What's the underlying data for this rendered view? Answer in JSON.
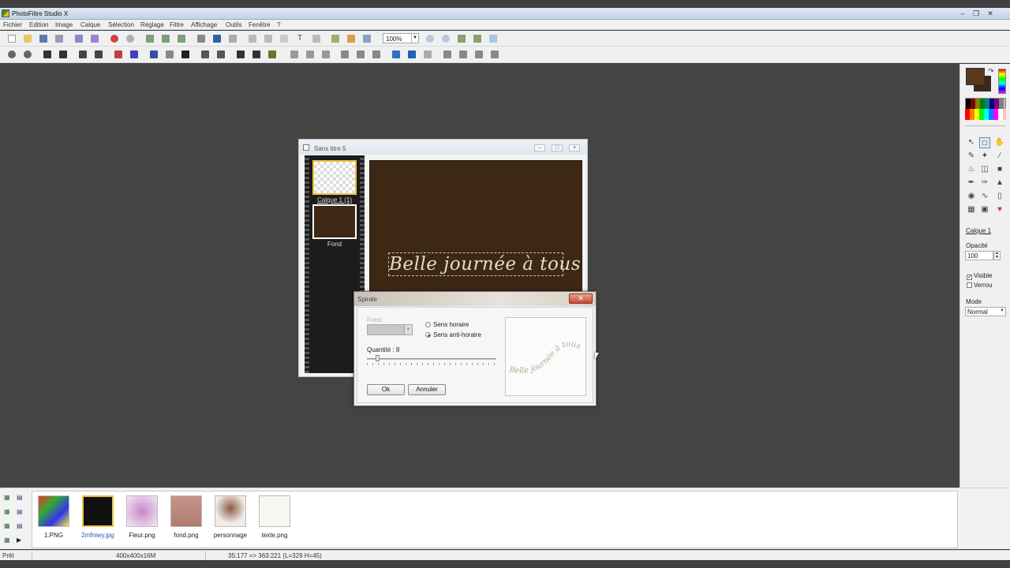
{
  "window": {
    "title": "PhotoFiltre Studio X"
  },
  "menu": [
    "Fichier",
    "Edition",
    "Image",
    "Calque",
    "Sélection",
    "Réglage",
    "Filtre",
    "Affichage",
    "Outils",
    "Fenêtre",
    "?"
  ],
  "toolbar": {
    "zoom": "100%"
  },
  "document": {
    "title": "Sans titre 5",
    "layers": [
      {
        "label": "Calque 1 (1)"
      },
      {
        "label": "Fond"
      }
    ],
    "canvas_text": "Belle journée à tous",
    "canvas_color": "#3c2814"
  },
  "dialog": {
    "title": "Spirale",
    "fond_label": "Fond :",
    "radio_clockwise": "Sens horaire",
    "radio_counter": "Sens anti-horaire",
    "selected_direction": "Sens anti-horaire",
    "quantity_label": "Quantité : 8",
    "quantity": 8,
    "ok": "Ok",
    "cancel": "Annuler",
    "preview_text": "Belle journée à tous"
  },
  "right_panel": {
    "layer_name": "Calque 1",
    "opacity_label": "Opacité",
    "opacity_value": "100",
    "visible_label": "Visible",
    "lock_label": "Verrou",
    "mode_label": "Mode",
    "mode_value": "Normal",
    "primary_color": "#5a3a1c",
    "secondary_color": "#3c2814"
  },
  "files": [
    {
      "name": "1.PNG"
    },
    {
      "name": "2mfniwy.jpg"
    },
    {
      "name": "Fleur.png"
    },
    {
      "name": "fond.png"
    },
    {
      "name": "personnage"
    },
    {
      "name": "texte.png"
    }
  ],
  "status": {
    "state": "Prêt",
    "size": "400x400x16M",
    "coords": "35:177 => 363:221 (L=329 H=45)"
  }
}
